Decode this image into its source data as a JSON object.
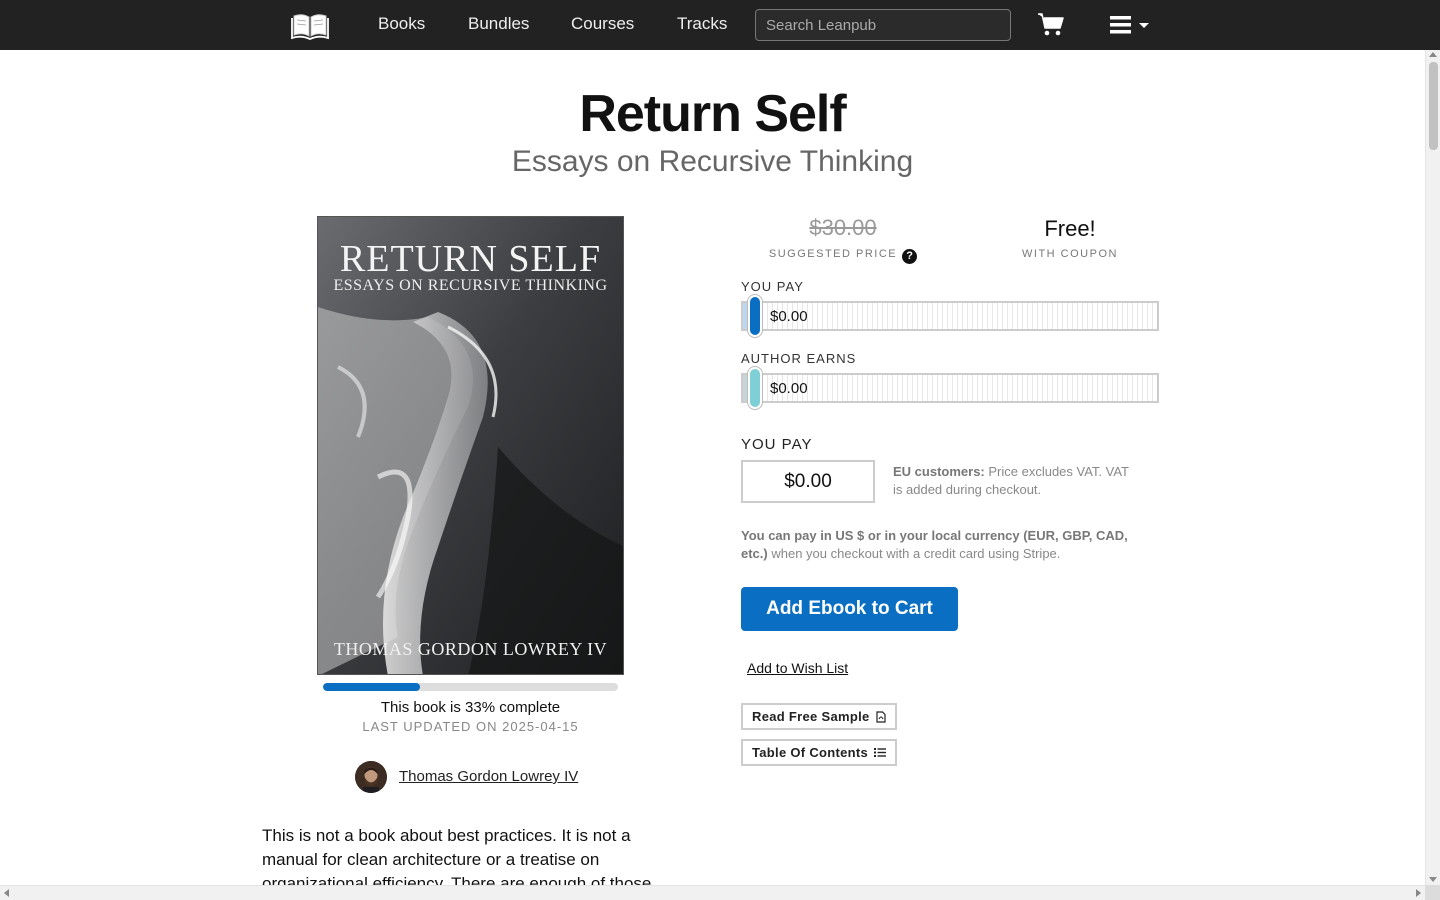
{
  "nav": {
    "links": [
      "Books",
      "Bundles",
      "Courses",
      "Tracks"
    ],
    "search_placeholder": "Search Leanpub"
  },
  "book": {
    "title": "Return Self",
    "subtitle": "Essays on Recursive Thinking",
    "cover": {
      "title": "RETURN SELF",
      "subtitle": "ESSAYS ON RECURSIVE THINKING",
      "author": "THOMAS GORDON LOWREY IV"
    },
    "progress_percent": 33,
    "progress_text": "This book is 33% complete",
    "last_updated": "LAST UPDATED ON 2025-04-15",
    "author_name": "Thomas Gordon Lowrey IV",
    "blurb": "This is not a book about best practices. It is not a manual for clean architecture or a treatise on organizational efficiency. There are enough of those"
  },
  "pricing": {
    "suggested_price": "$30.00",
    "suggested_label": "SUGGESTED PRICE",
    "coupon_price": "Free!",
    "coupon_label": "WITH COUPON",
    "you_pay_label": "YOU PAY",
    "you_pay_value": "$0.00",
    "author_earns_label": "AUTHOR EARNS",
    "author_earns_value": "$0.00",
    "you_pay_big_label": "YOU PAY",
    "price_input_value": "$0.00",
    "eu_bold": "EU customers:",
    "eu_text": " Price excludes VAT. VAT is added during checkout.",
    "currency_bold": "You can pay in US $ or in your local currency (EUR, GBP, CAD, etc.)",
    "currency_text": " when you checkout with a credit card using Stripe.",
    "add_to_cart": "Add Ebook to Cart",
    "wish_list": "Add to Wish List",
    "read_sample": "Read Free Sample",
    "table_of_contents": "Table Of Contents"
  },
  "colors": {
    "nav_bg": "#222222",
    "accent": "#0a6fc2",
    "author_slider": "#7fcfd6"
  }
}
